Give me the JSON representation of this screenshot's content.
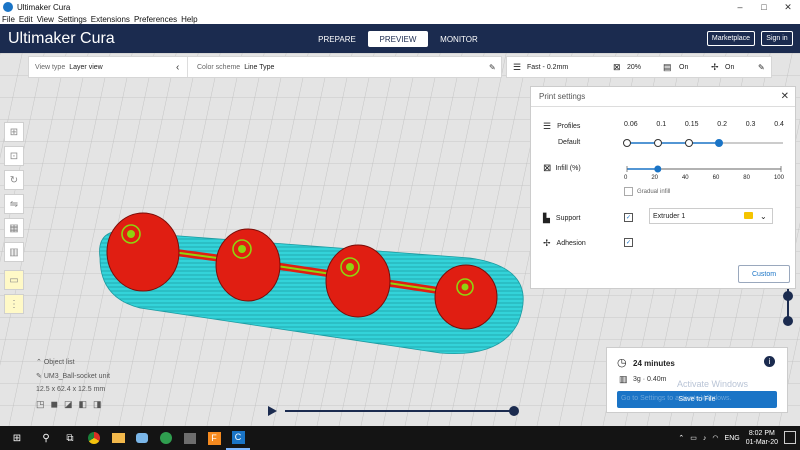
{
  "window": {
    "title": "Ultimaker Cura",
    "controls": [
      "–",
      "□",
      "✕"
    ]
  },
  "menu": [
    "File",
    "Edit",
    "View",
    "Settings",
    "Extensions",
    "Preferences",
    "Help"
  ],
  "header": {
    "logo": "Ultimaker Cura",
    "tabs": [
      "PREPARE",
      "PREVIEW",
      "MONITOR"
    ],
    "active_tab": "PREVIEW",
    "marketplace": "Marketplace",
    "signin": "Sign in"
  },
  "viewbar": {
    "view_type_label": "View type",
    "view_type_value": "Layer view",
    "color_scheme_label": "Color scheme",
    "color_scheme_value": "Line Type"
  },
  "printbar": {
    "profile": "Fast - 0.2mm",
    "infill": "20%",
    "support": "On",
    "adhesion": "On"
  },
  "print_settings": {
    "title": "Print settings",
    "profiles_label": "Profiles",
    "default_label": "Default",
    "layer_heights": [
      "0.06",
      "0.1",
      "0.15",
      "0.2",
      "0.3",
      "0.4"
    ],
    "selected_layer_height": "0.2",
    "infill_label": "Infill (%)",
    "infill_ticks": [
      "0",
      "20",
      "40",
      "60",
      "80",
      "100"
    ],
    "infill_value": 20,
    "gradual_infill": "Gradual infill",
    "support_label": "Support",
    "extruder": "Extruder 1",
    "adhesion_label": "Adhesion",
    "customize": "Custom"
  },
  "object": {
    "list_label": "Object list",
    "name": "UM3_Ball-socket unit",
    "dims": "12.5 x 62.4 x 12.5 mm"
  },
  "estimate": {
    "time": "24 minutes",
    "material": "3g · 0.40m",
    "save": "Save to File",
    "watermark_title": "Activate Windows",
    "watermark_sub": "Go to Settings to activate Windows."
  },
  "taskbar": {
    "lang": "ENG",
    "time": "8:02 PM",
    "date": "01-Mar-20"
  },
  "colors": {
    "header": "#1b2b4f",
    "accent": "#1a74c6",
    "wall": "#e01e12",
    "skirt": "#33d3d9",
    "infill": "#8fd40f"
  }
}
